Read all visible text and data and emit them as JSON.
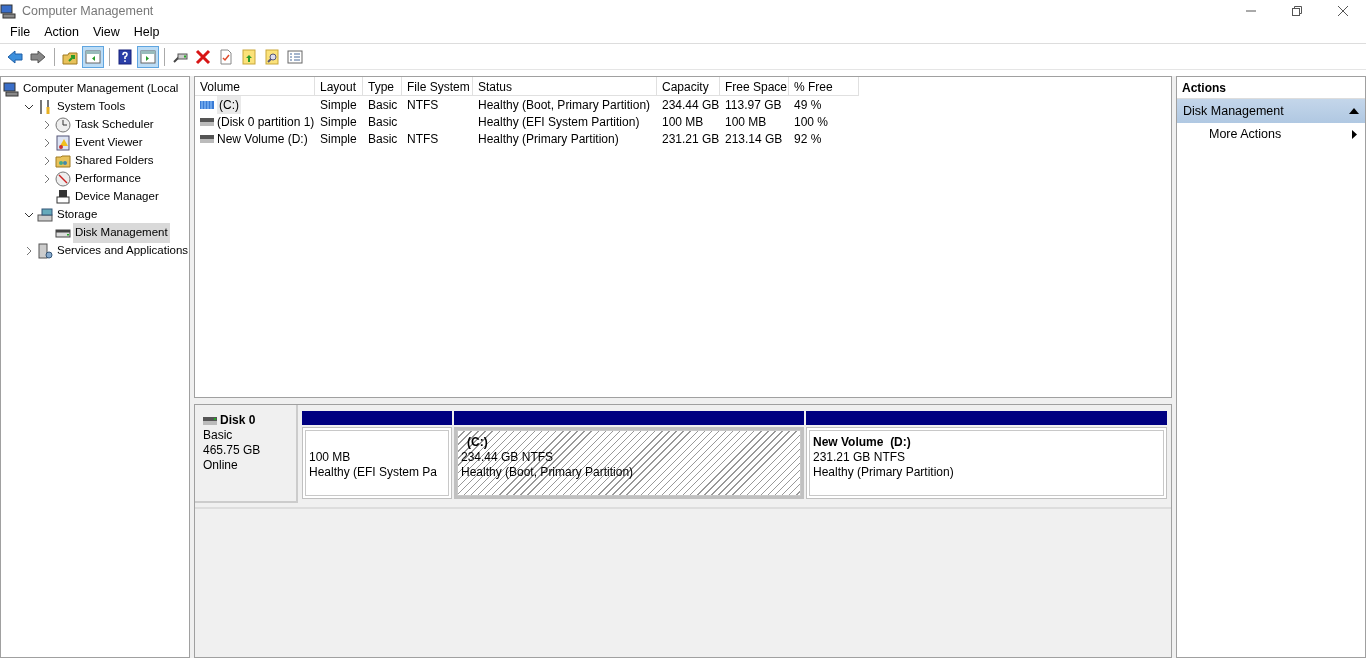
{
  "window": {
    "title": "Computer Management"
  },
  "menu": [
    "File",
    "Action",
    "View",
    "Help"
  ],
  "toolbar": [
    [
      {
        "kind": "back",
        "on": false
      },
      {
        "kind": "forward",
        "on": false
      }
    ],
    [
      {
        "kind": "up",
        "on": false
      },
      {
        "kind": "tree",
        "on": true
      }
    ],
    [
      {
        "kind": "help",
        "on": false
      },
      {
        "kind": "pane",
        "on": true
      }
    ],
    [
      {
        "kind": "connect",
        "on": false
      },
      {
        "kind": "delete",
        "on": false
      },
      {
        "kind": "check",
        "on": false
      },
      {
        "kind": "export",
        "on": false
      },
      {
        "kind": "find",
        "on": false
      },
      {
        "kind": "props",
        "on": false
      }
    ]
  ],
  "tree": [
    {
      "label": "Computer Management (Local",
      "kind": "computer",
      "selected": false,
      "children": [
        {
          "label": "System Tools",
          "kind": "tools",
          "expanded": true,
          "selected": false,
          "children": [
            {
              "label": "Task Scheduler",
              "kind": "clock",
              "expanded": false,
              "selected": false
            },
            {
              "label": "Event Viewer",
              "kind": "log",
              "expanded": false,
              "selected": false
            },
            {
              "label": "Shared Folders",
              "kind": "folder",
              "expanded": false,
              "selected": false
            },
            {
              "label": "Performance",
              "kind": "gauge",
              "expanded": false,
              "selected": false
            },
            {
              "label": "Device Manager",
              "kind": "device",
              "selected": false
            }
          ]
        },
        {
          "label": "Storage",
          "kind": "storage",
          "expanded": true,
          "selected": false,
          "children": [
            {
              "label": "Disk Management",
              "kind": "disk",
              "selected": true
            }
          ]
        },
        {
          "label": "Services and Applications",
          "kind": "services",
          "expanded": false,
          "selected": false
        }
      ]
    }
  ],
  "table": {
    "columns": [
      "Volume",
      "Layout",
      "Type",
      "File System",
      "Status",
      "Capacity",
      "Free Space",
      "% Free"
    ],
    "rows": [
      {
        "kind": "striped",
        "selected": true,
        "cells": [
          "(C:)",
          "Simple",
          "Basic",
          "NTFS",
          "Healthy (Boot, Primary Partition)",
          "234.44 GB",
          "113.97 GB",
          "49 %"
        ]
      },
      {
        "kind": "plain",
        "selected": false,
        "cells": [
          "(Disk 0 partition 1)",
          "Simple",
          "Basic",
          "",
          "Healthy (EFI System Partition)",
          "100 MB",
          "100 MB",
          "100 %"
        ]
      },
      {
        "kind": "plain",
        "selected": false,
        "cells": [
          "New Volume (D:)",
          "Simple",
          "Basic",
          "NTFS",
          "Healthy (Primary Partition)",
          "231.21 GB",
          "213.14 GB",
          "92 %"
        ]
      }
    ]
  },
  "disks": [
    {
      "name": "Disk 0",
      "lines": [
        "Basic",
        "465.75 GB",
        "Online"
      ],
      "partitions": [
        {
          "size": "100 MB",
          "status": "Healthy (EFI System Pa",
          "selected": false
        },
        {
          "name": "(C:)",
          "size": "234.44 GB NTFS",
          "status": "Healthy (Boot, Primary Partition)",
          "selected": true
        },
        {
          "name": "New Volume  (D:)",
          "size": "231.21 GB NTFS",
          "status": "Healthy (Primary Partition)",
          "selected": false
        }
      ]
    }
  ],
  "actions": {
    "title": "Actions",
    "sections": [
      {
        "label": "Disk Management",
        "expanded": true,
        "items": [
          {
            "label": "More Actions",
            "submenu": true
          }
        ]
      }
    ]
  }
}
